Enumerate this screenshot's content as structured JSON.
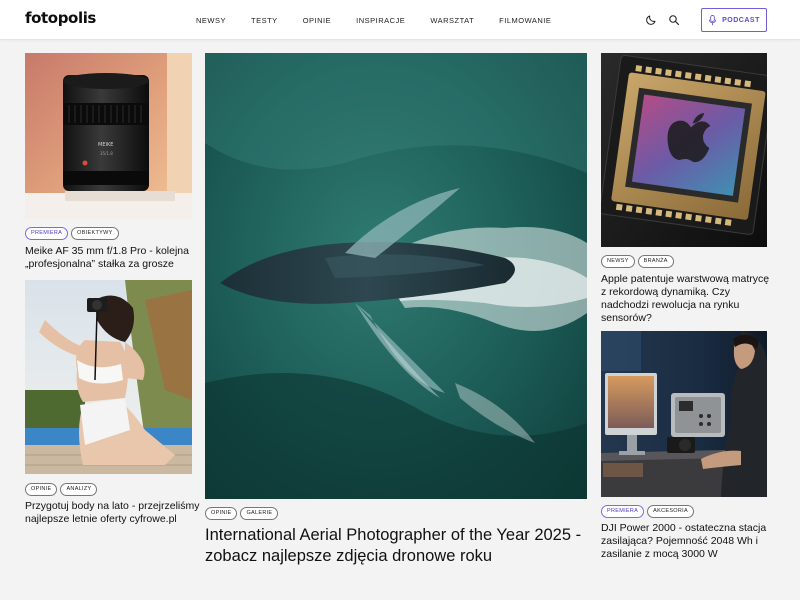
{
  "header": {
    "logo": "fotopolis",
    "nav": [
      "NEWSY",
      "TESTY",
      "OPINIE",
      "INSPIRACJE",
      "WARSZTAT",
      "FILMOWANIE"
    ],
    "podcast_label": "PODCAST",
    "icons": [
      "moon-icon",
      "search-icon",
      "microphone-icon"
    ],
    "accent_color": "#6e5fd8"
  },
  "cards": [
    {
      "id": "lens",
      "tags": [
        "PREMIERA",
        "OBIEKTYWY"
      ],
      "title_lines": [
        "Meike AF 35 mm f/1.8 Pro - kolejna",
        "„profesjonalna” stałka za grosze"
      ]
    },
    {
      "id": "woman",
      "tags": [
        "OPINIE",
        "ANALIZY"
      ],
      "title_lines": [
        "Przygotuj body na lato - przejrzeliśmy",
        "najlepsze letnie oferty cyfrowe.pl"
      ]
    },
    {
      "id": "whale",
      "tags": [
        "OPINIE",
        "GALERIE"
      ],
      "title_lines": [
        "International Aerial Photographer of the Year 2025 -",
        "zobacz najlepsze zdjęcia dronowe roku"
      ]
    },
    {
      "id": "chip",
      "tags": [
        "NEWSY",
        "BRANŻA"
      ],
      "title_lines": [
        "Apple patentuje warstwową matrycę",
        "z rekordową dynamiką. Czy",
        "nadchodzi rewolucja na rynku",
        "sensorów?"
      ]
    },
    {
      "id": "power",
      "tags": [
        "PREMIERA",
        "AKCESORIA"
      ],
      "title_lines": [
        "DJI Power 2000 - ostateczna stacja",
        "zasilająca? Pojemność 2048 Wh i",
        "zasilanie z mocą 3000 W"
      ]
    }
  ],
  "image_text": {
    "lens_brand": "MEIKE",
    "lens_model": "35/1.8"
  }
}
